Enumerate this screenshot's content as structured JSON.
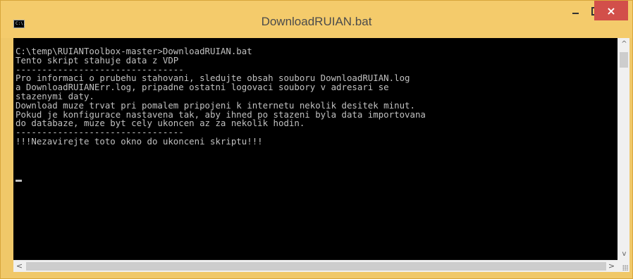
{
  "window": {
    "title": "DownloadRUIAN.bat",
    "icon_label": "C:\\.",
    "buttons": {
      "minimize": "minimize-icon",
      "maximize": "maximize-icon",
      "close": "×"
    }
  },
  "console": {
    "output": "C:\\temp\\RUIANToolbox-master>DownloadRUIAN.bat\nTento skript stahuje data z VDP\n--------------------------------\nPro informaci o prubehu stahovani, sledujte obsah souboru DownloadRUIAN.log\na DownloadRUIANErr.log, pripadne ostatni logovaci soubory v adresari se\nstazenymi daty.\nDownload muze trvat pri pomalem pripojeni k internetu nekolik desitek minut.\nPokud je konfigurace nastavena tak, aby ihned po stazeni byla data importovana\ndo databaze, muze byt cely ukoncen az za nekolik hodin.\n--------------------------------\n!!!Nezavirejte toto okno do ukonceni skriptu!!!",
    "background": "#000000",
    "text_color": "#c0c0c0"
  },
  "scrollbars": {
    "up_arrow": "^",
    "down_arrow": "v",
    "left_arrow": "<",
    "right_arrow": ">"
  },
  "colors": {
    "title_bar": "#f4cb6b",
    "close_button": "#d24f4a"
  }
}
